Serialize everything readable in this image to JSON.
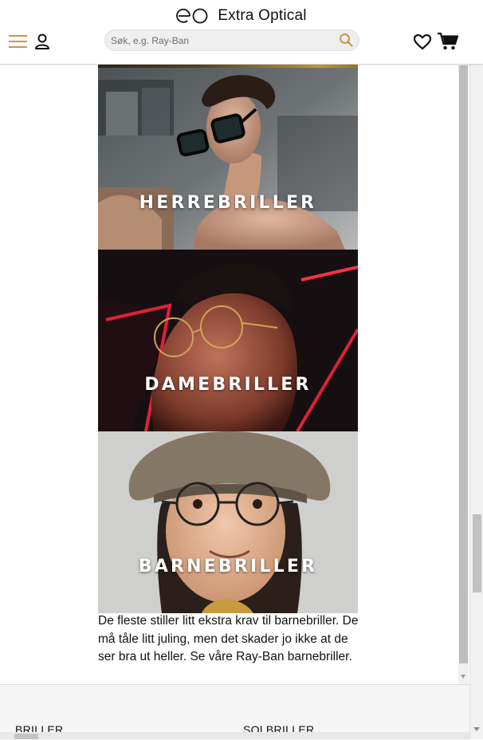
{
  "header": {
    "brand_name": "Extra Optical",
    "search_placeholder": "Søk, e.g. Ray-Ban",
    "icons": [
      "hamburger-menu-icon",
      "user-icon",
      "search-icon",
      "heart-icon",
      "cart-icon"
    ],
    "accent_color": "#c8964a"
  },
  "categories": [
    {
      "label": "HERREBRILLER"
    },
    {
      "label": "DAMEBRILLER"
    },
    {
      "label": "BARNEBRILLER"
    }
  ],
  "description": "De fleste stiller litt ekstra krav til barnebriller. De må tåle litt juling, men det skader jo ikke at de ser bra ut heller. Se våre Ray-Ban barnebriller.",
  "footer": {
    "links": [
      "BRILLER",
      "SOLBRILLER"
    ]
  }
}
